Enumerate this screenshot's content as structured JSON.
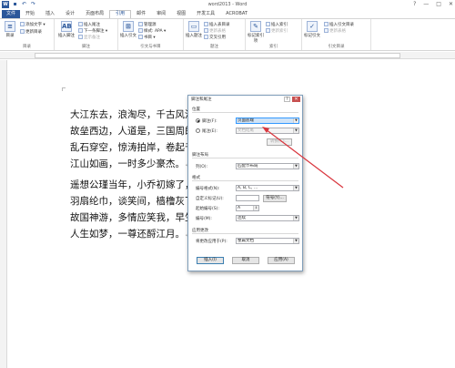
{
  "window": {
    "title": "word2013 - Word",
    "min": "—",
    "max": "□",
    "close": "✕",
    "help": "?",
    "logo_text": "W"
  },
  "quick_access": [
    "save-icon",
    "undo-icon",
    "redo-icon"
  ],
  "tabs": [
    "开始",
    "插入",
    "设计",
    "页面布局",
    "引用",
    "邮件",
    "审阅",
    "视图",
    "开发工具",
    "ACROBAT"
  ],
  "file_tab": "文件",
  "active_tab": "引用",
  "ribbon": {
    "toc": {
      "big": "目录",
      "small": [
        "添加文字 ▾",
        "更新目录"
      ],
      "group": "目录"
    },
    "footnote": {
      "big": "插入脚注",
      "big_icon": "AB",
      "small": [
        "插入尾注",
        "下一条脚注 ▾",
        "显示备注"
      ],
      "group": "脚注"
    },
    "citation": {
      "big": "插入引文",
      "small": [
        "管理源",
        "样式: APA ▾",
        "书目 ▾"
      ],
      "group": "引文与书目"
    },
    "caption": {
      "big": "插入题注",
      "small": [
        "插入表目录",
        "更新表格",
        "交叉引用"
      ],
      "group": "题注"
    },
    "index": {
      "big": "标记索引项",
      "small": [
        "插入索引",
        "更新索引"
      ],
      "group": "索引"
    },
    "toa": {
      "big": "标记引文",
      "small": [
        "插入引文目录",
        "更新表格"
      ],
      "group": "引文目录"
    }
  },
  "document": {
    "lines": [
      "大江东去，浪淘尽，千古风流人物。",
      "故垒西边，人道是，三国周郎赤壁。",
      "乱石穿空，惊涛拍岸，卷起千堆雪。",
      "江山如画，一时多少豪杰。",
      "遥想公瑾当年，小乔初嫁了，雄姿英发。",
      "羽扇纶巾，谈笑间，樯橹灰飞烟灭。",
      "故国神游，多情应笑我，早生华发。",
      "人生如梦，一尊还酹江月。"
    ],
    "para_mark": "↵"
  },
  "dialog": {
    "title": "脚注和尾注",
    "location_label": "位置",
    "footnote_label": "脚注(F):",
    "footnote_value": "页面底端",
    "endnote_label": "尾注(E):",
    "endnote_value": "文档结尾",
    "convert_button": "转换(C)...",
    "layout_label": "脚注布局",
    "columns_label": "列(O):",
    "columns_value": "匹配节布局",
    "format_label": "格式",
    "number_format_label": "编号格式(N):",
    "number_format_value": "A, B, C, ...",
    "custom_mark_label": "自定义标记(U):",
    "symbol_button": "符号(Y)...",
    "start_at_label": "起始编号(S):",
    "start_at_value": "A",
    "numbering_label": "编号(M):",
    "numbering_value": "连续",
    "apply_label": "应用更改",
    "apply_to_label": "将更改应用于(P):",
    "apply_to_value": "整篇文档",
    "insert_button": "插入(I)",
    "cancel_button": "取消",
    "apply_button": "应用(A)"
  },
  "annotation_color": "#d9363e"
}
